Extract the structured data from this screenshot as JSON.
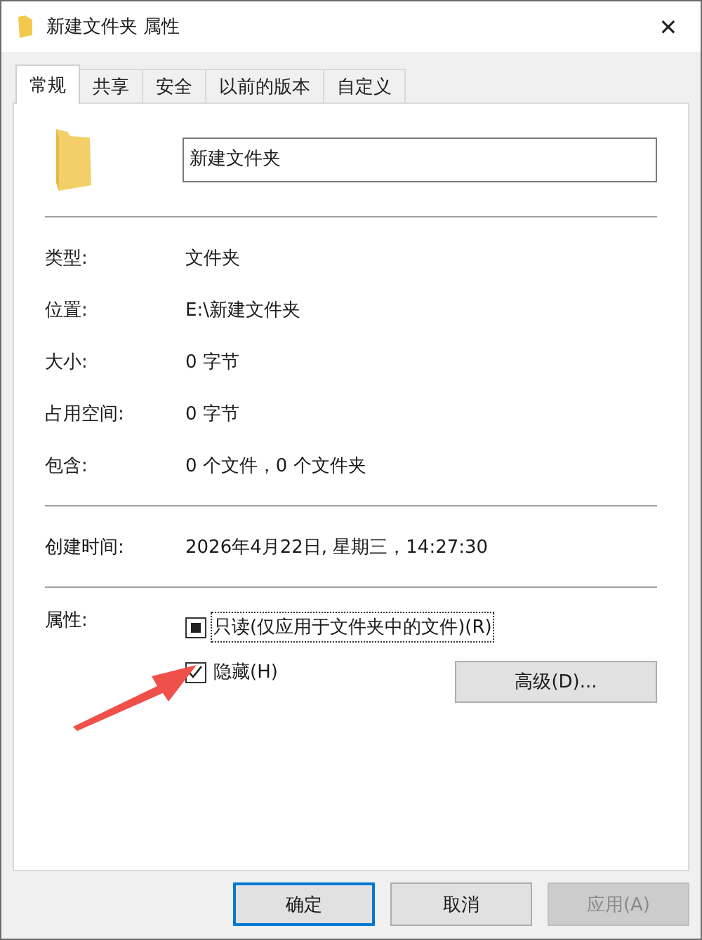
{
  "window": {
    "title": "新建文件夹 属性",
    "close": "✕"
  },
  "tabs": [
    {
      "label": "常规",
      "selected": true
    },
    {
      "label": "共享",
      "selected": false
    },
    {
      "label": "安全",
      "selected": false
    },
    {
      "label": "以前的版本",
      "selected": false
    },
    {
      "label": "自定义",
      "selected": false
    }
  ],
  "name_field": {
    "value": "新建文件夹"
  },
  "info_groups": [
    [
      {
        "label": "类型:",
        "value": "文件夹"
      },
      {
        "label": "位置:",
        "value": "E:\\新建文件夹"
      },
      {
        "label": "大小:",
        "value": "0 字节"
      },
      {
        "label": "占用空间:",
        "value": "0 字节"
      },
      {
        "label": "包含:",
        "value": "0 个文件，0 个文件夹"
      }
    ],
    [
      {
        "label": "创建时间:",
        "value": "2026年4月22日, 星期三，14:27:30"
      }
    ]
  ],
  "attributes": {
    "label": "属性:",
    "options": [
      {
        "label": "只读(仅应用于文件夹中的文件)(R)",
        "checked": false,
        "indeterminate": true,
        "focused": true
      },
      {
        "label": "隐藏(H)",
        "checked": true,
        "indeterminate": false,
        "focused": false
      }
    ],
    "advanced_button": "高级(D)..."
  },
  "annotations": [
    {
      "kind": "arrow",
      "color": "#f0504a"
    }
  ],
  "buttons": [
    {
      "label": "确定",
      "default": true,
      "disabled": false
    },
    {
      "label": "取消",
      "default": false,
      "disabled": false
    },
    {
      "label": "应用(A)",
      "default": false,
      "disabled": true
    }
  ]
}
